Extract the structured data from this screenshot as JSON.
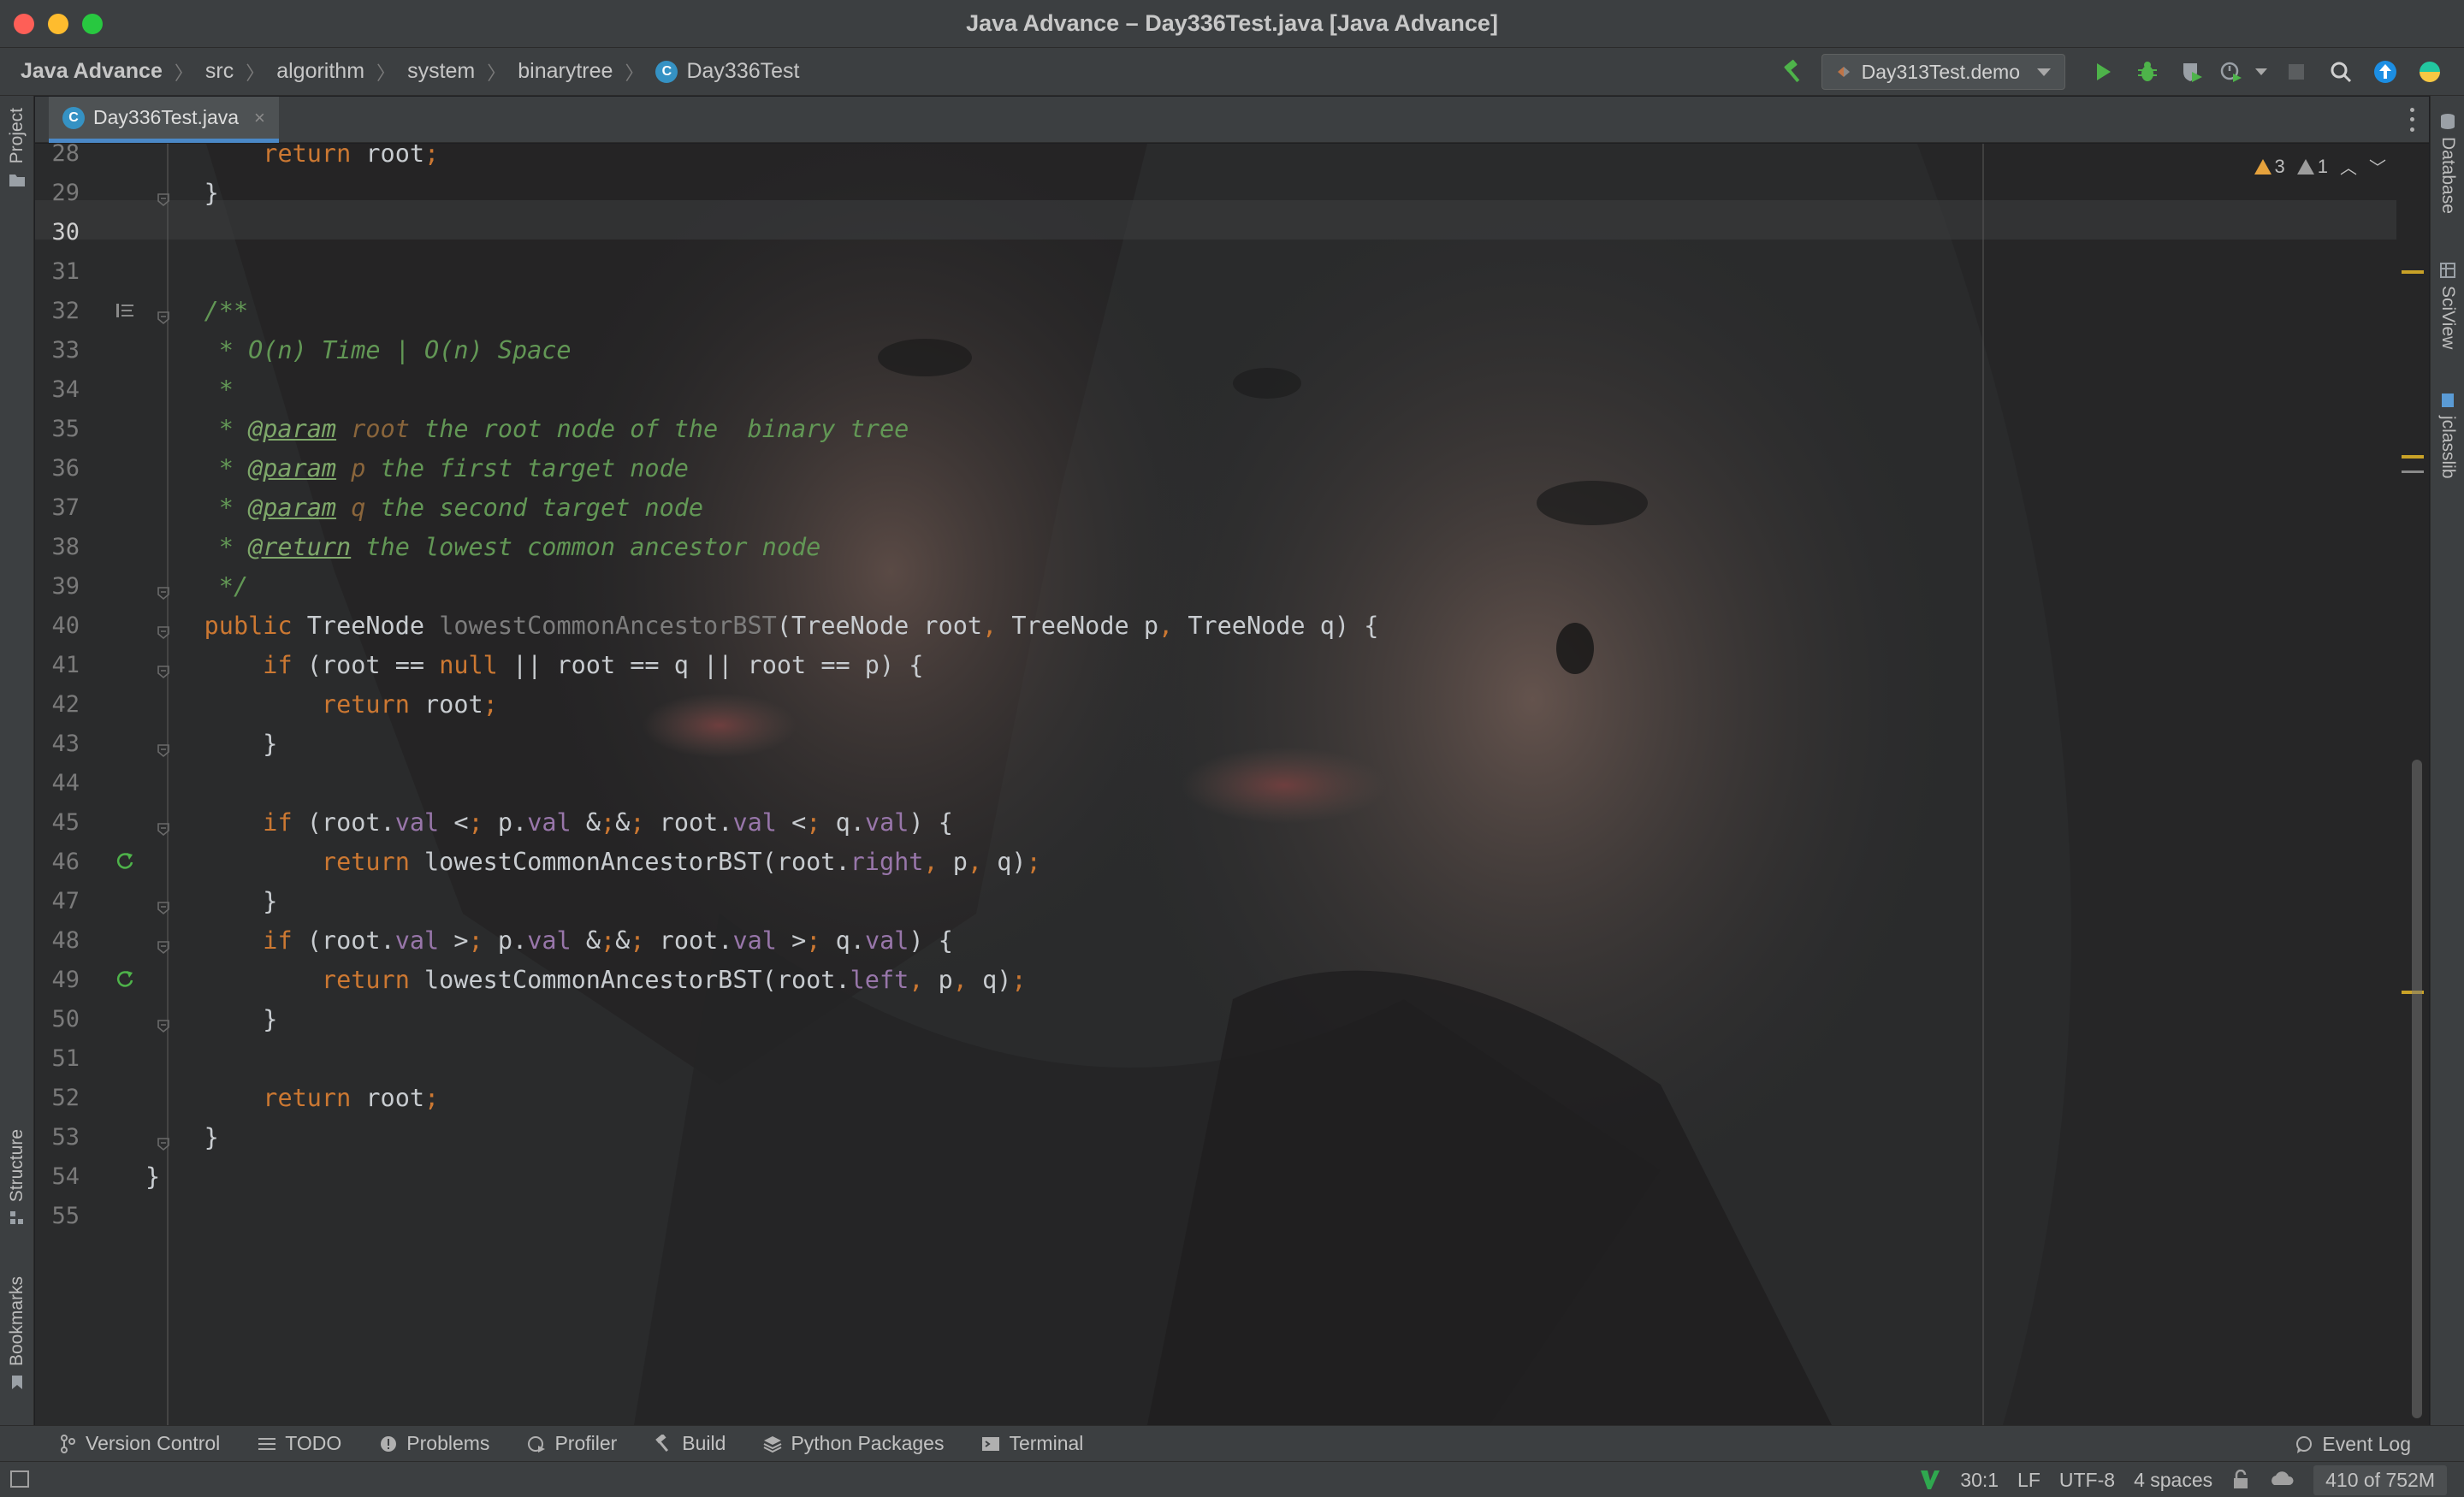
{
  "window": {
    "title": "Java Advance – Day336Test.java [Java Advance]"
  },
  "breadcrumbs": [
    "Java Advance",
    "src",
    "algorithm",
    "system",
    "binarytree",
    "Day336Test"
  ],
  "toolbar": {
    "run_config": "Day313Test.demo"
  },
  "left_stripe": {
    "project": "Project",
    "structure": "Structure",
    "bookmarks": "Bookmarks"
  },
  "right_stripe": {
    "database": "Database",
    "sciview": "SciView",
    "jclasslib": "jclasslib"
  },
  "tab": {
    "file_name": "Day336Test.java",
    "close_glyph": "×"
  },
  "inspections": {
    "warnings": "3",
    "weak_warnings": "1"
  },
  "editor": {
    "current_line": "30",
    "lines": [
      {
        "n": "28",
        "code": "        return root;"
      },
      {
        "n": "29",
        "code": "    }"
      },
      {
        "n": "30",
        "code": ""
      },
      {
        "n": "31",
        "code": ""
      },
      {
        "n": "32",
        "code": "    /**"
      },
      {
        "n": "33",
        "code": "     * O(n) Time | O(n) Space"
      },
      {
        "n": "34",
        "code": "     *"
      },
      {
        "n": "35",
        "code": "     * @param root the root node of the  binary tree"
      },
      {
        "n": "36",
        "code": "     * @param p the first target node"
      },
      {
        "n": "37",
        "code": "     * @param q the second target node"
      },
      {
        "n": "38",
        "code": "     * @return the lowest common ancestor node"
      },
      {
        "n": "39",
        "code": "     */"
      },
      {
        "n": "40",
        "code": "    public TreeNode lowestCommonAncestorBST(TreeNode root, TreeNode p, TreeNode q) {"
      },
      {
        "n": "41",
        "code": "        if (root == null || root == q || root == p) {"
      },
      {
        "n": "42",
        "code": "            return root;"
      },
      {
        "n": "43",
        "code": "        }"
      },
      {
        "n": "44",
        "code": ""
      },
      {
        "n": "45",
        "code": "        if (root.val < p.val && root.val < q.val) {"
      },
      {
        "n": "46",
        "code": "            return lowestCommonAncestorBST(root.right, p, q);"
      },
      {
        "n": "47",
        "code": "        }"
      },
      {
        "n": "48",
        "code": "        if (root.val > p.val && root.val > q.val) {"
      },
      {
        "n": "49",
        "code": "            return lowestCommonAncestorBST(root.left, p, q);"
      },
      {
        "n": "50",
        "code": "        }"
      },
      {
        "n": "51",
        "code": ""
      },
      {
        "n": "52",
        "code": "        return root;"
      },
      {
        "n": "53",
        "code": "    }"
      },
      {
        "n": "54",
        "code": "}"
      },
      {
        "n": "55",
        "code": ""
      }
    ]
  },
  "bottom_bar": {
    "items": [
      "Version Control",
      "TODO",
      "Problems",
      "Profiler",
      "Build",
      "Python Packages",
      "Terminal"
    ],
    "event_log": "Event Log"
  },
  "status": {
    "caret": "30:1",
    "line_sep": "LF",
    "encoding": "UTF-8",
    "indent": "4 spaces",
    "memory": "410 of 752M"
  },
  "colors": {
    "accent": "#4a88c7",
    "keyword": "#cc7832",
    "comment": "#629755",
    "field": "#9876aa",
    "warning": "#e6a23c",
    "run": "#4eb34a"
  },
  "icons": [
    "hammer-icon",
    "run-icon",
    "debug-icon",
    "coverage-icon",
    "profile-icon",
    "stop-icon",
    "search-icon",
    "update-icon",
    "plugin-icon"
  ]
}
